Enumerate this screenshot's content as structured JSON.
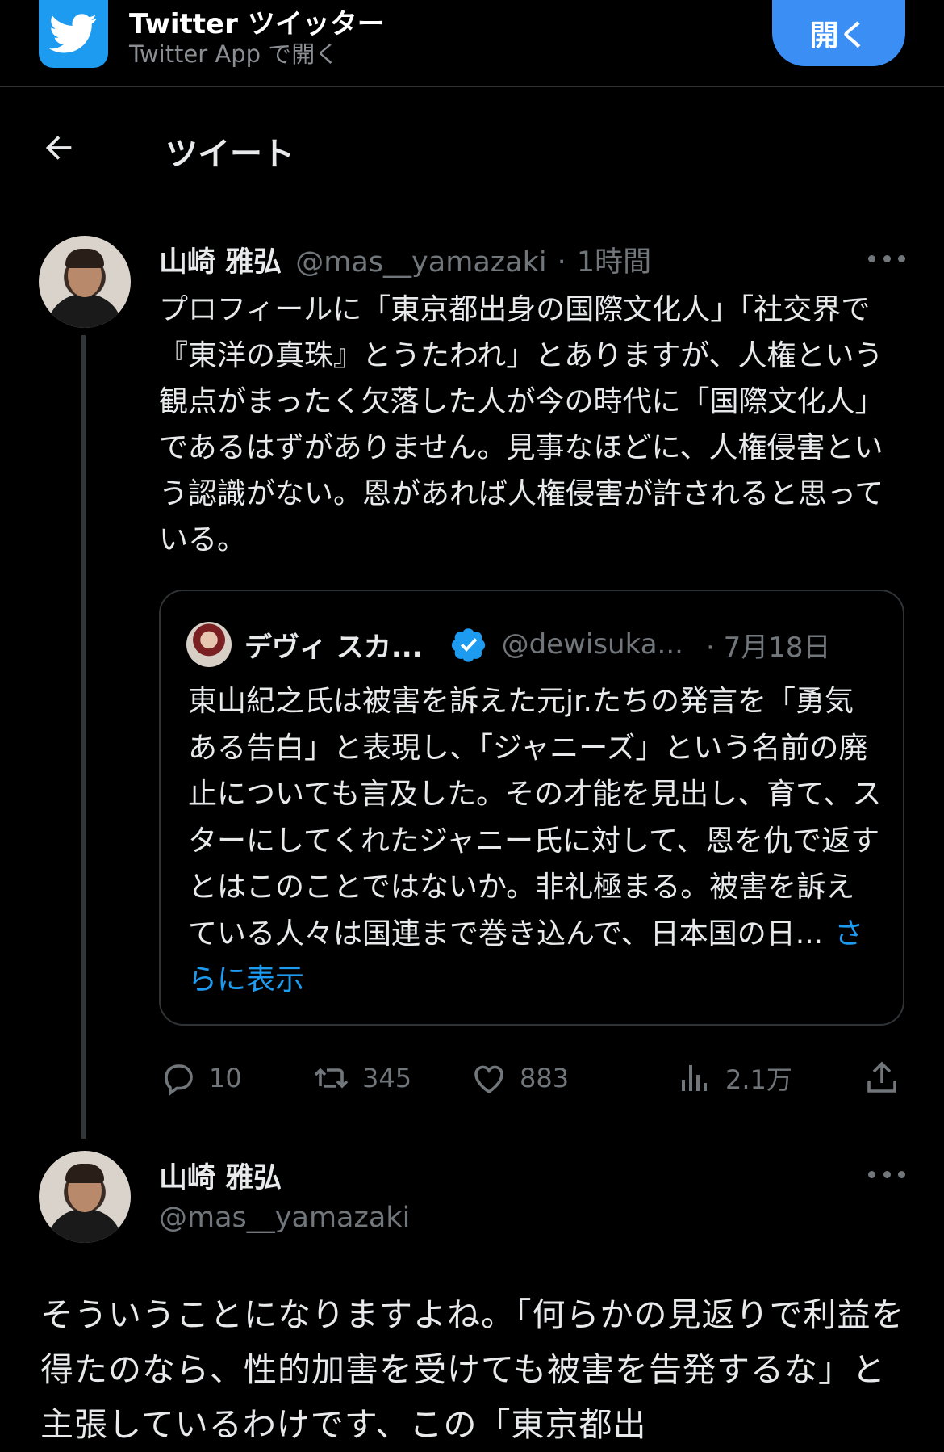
{
  "banner": {
    "app_name": "Twitter ツイッター",
    "app_sub": "Twitter App で開く",
    "open_label": "開く"
  },
  "header": {
    "title": "ツイート"
  },
  "tweet1": {
    "author_name": "山崎 雅弘",
    "handle": "@mas__yamazaki",
    "separator": "·",
    "time": "1時間",
    "text": "プロフィールに「東京都出身の国際文化人」「社交界で『東洋の真珠』とうたわれ」とありますが、人権という観点がまったく欠落した人が今の時代に「国際文化人」であるはずがありません。見事なほどに、人権侵害という認識がない。恩があれば人権侵害が許されると思っている。",
    "quote": {
      "name": "デヴィ スカ...",
      "handle": "@dewisuka...",
      "date": "· 7月18日",
      "text": "東山紀之氏は被害を訴えた元jr.たちの発言を「勇気ある告白」と表現し、「ジャニーズ」という名前の廃止についても言及した。その才能を見出し、育て、スターにしてくれたジャニー氏に対して、恩を仇で返すとはこのことではないか。非礼極まる。被害を訴えている人々は国連まで巻き込んで、日本国の日...",
      "show_more": "さらに表示"
    },
    "stats": {
      "replies": "10",
      "retweets": "345",
      "likes": "883",
      "views": "2.1万"
    }
  },
  "tweet2": {
    "author_name": "山崎 雅弘",
    "handle": "@mas__yamazaki",
    "text": "そういうことになりますよね。「何らかの見返りで利益を得たのなら、性的加害を受けても被害を告発するな」と主張しているわけです、この「東京都出"
  },
  "colors": {
    "background": "#000000",
    "text": "#e7e9ea",
    "muted": "#71767b",
    "accent": "#1d9bf0",
    "open_button": "#3b8ef3"
  }
}
